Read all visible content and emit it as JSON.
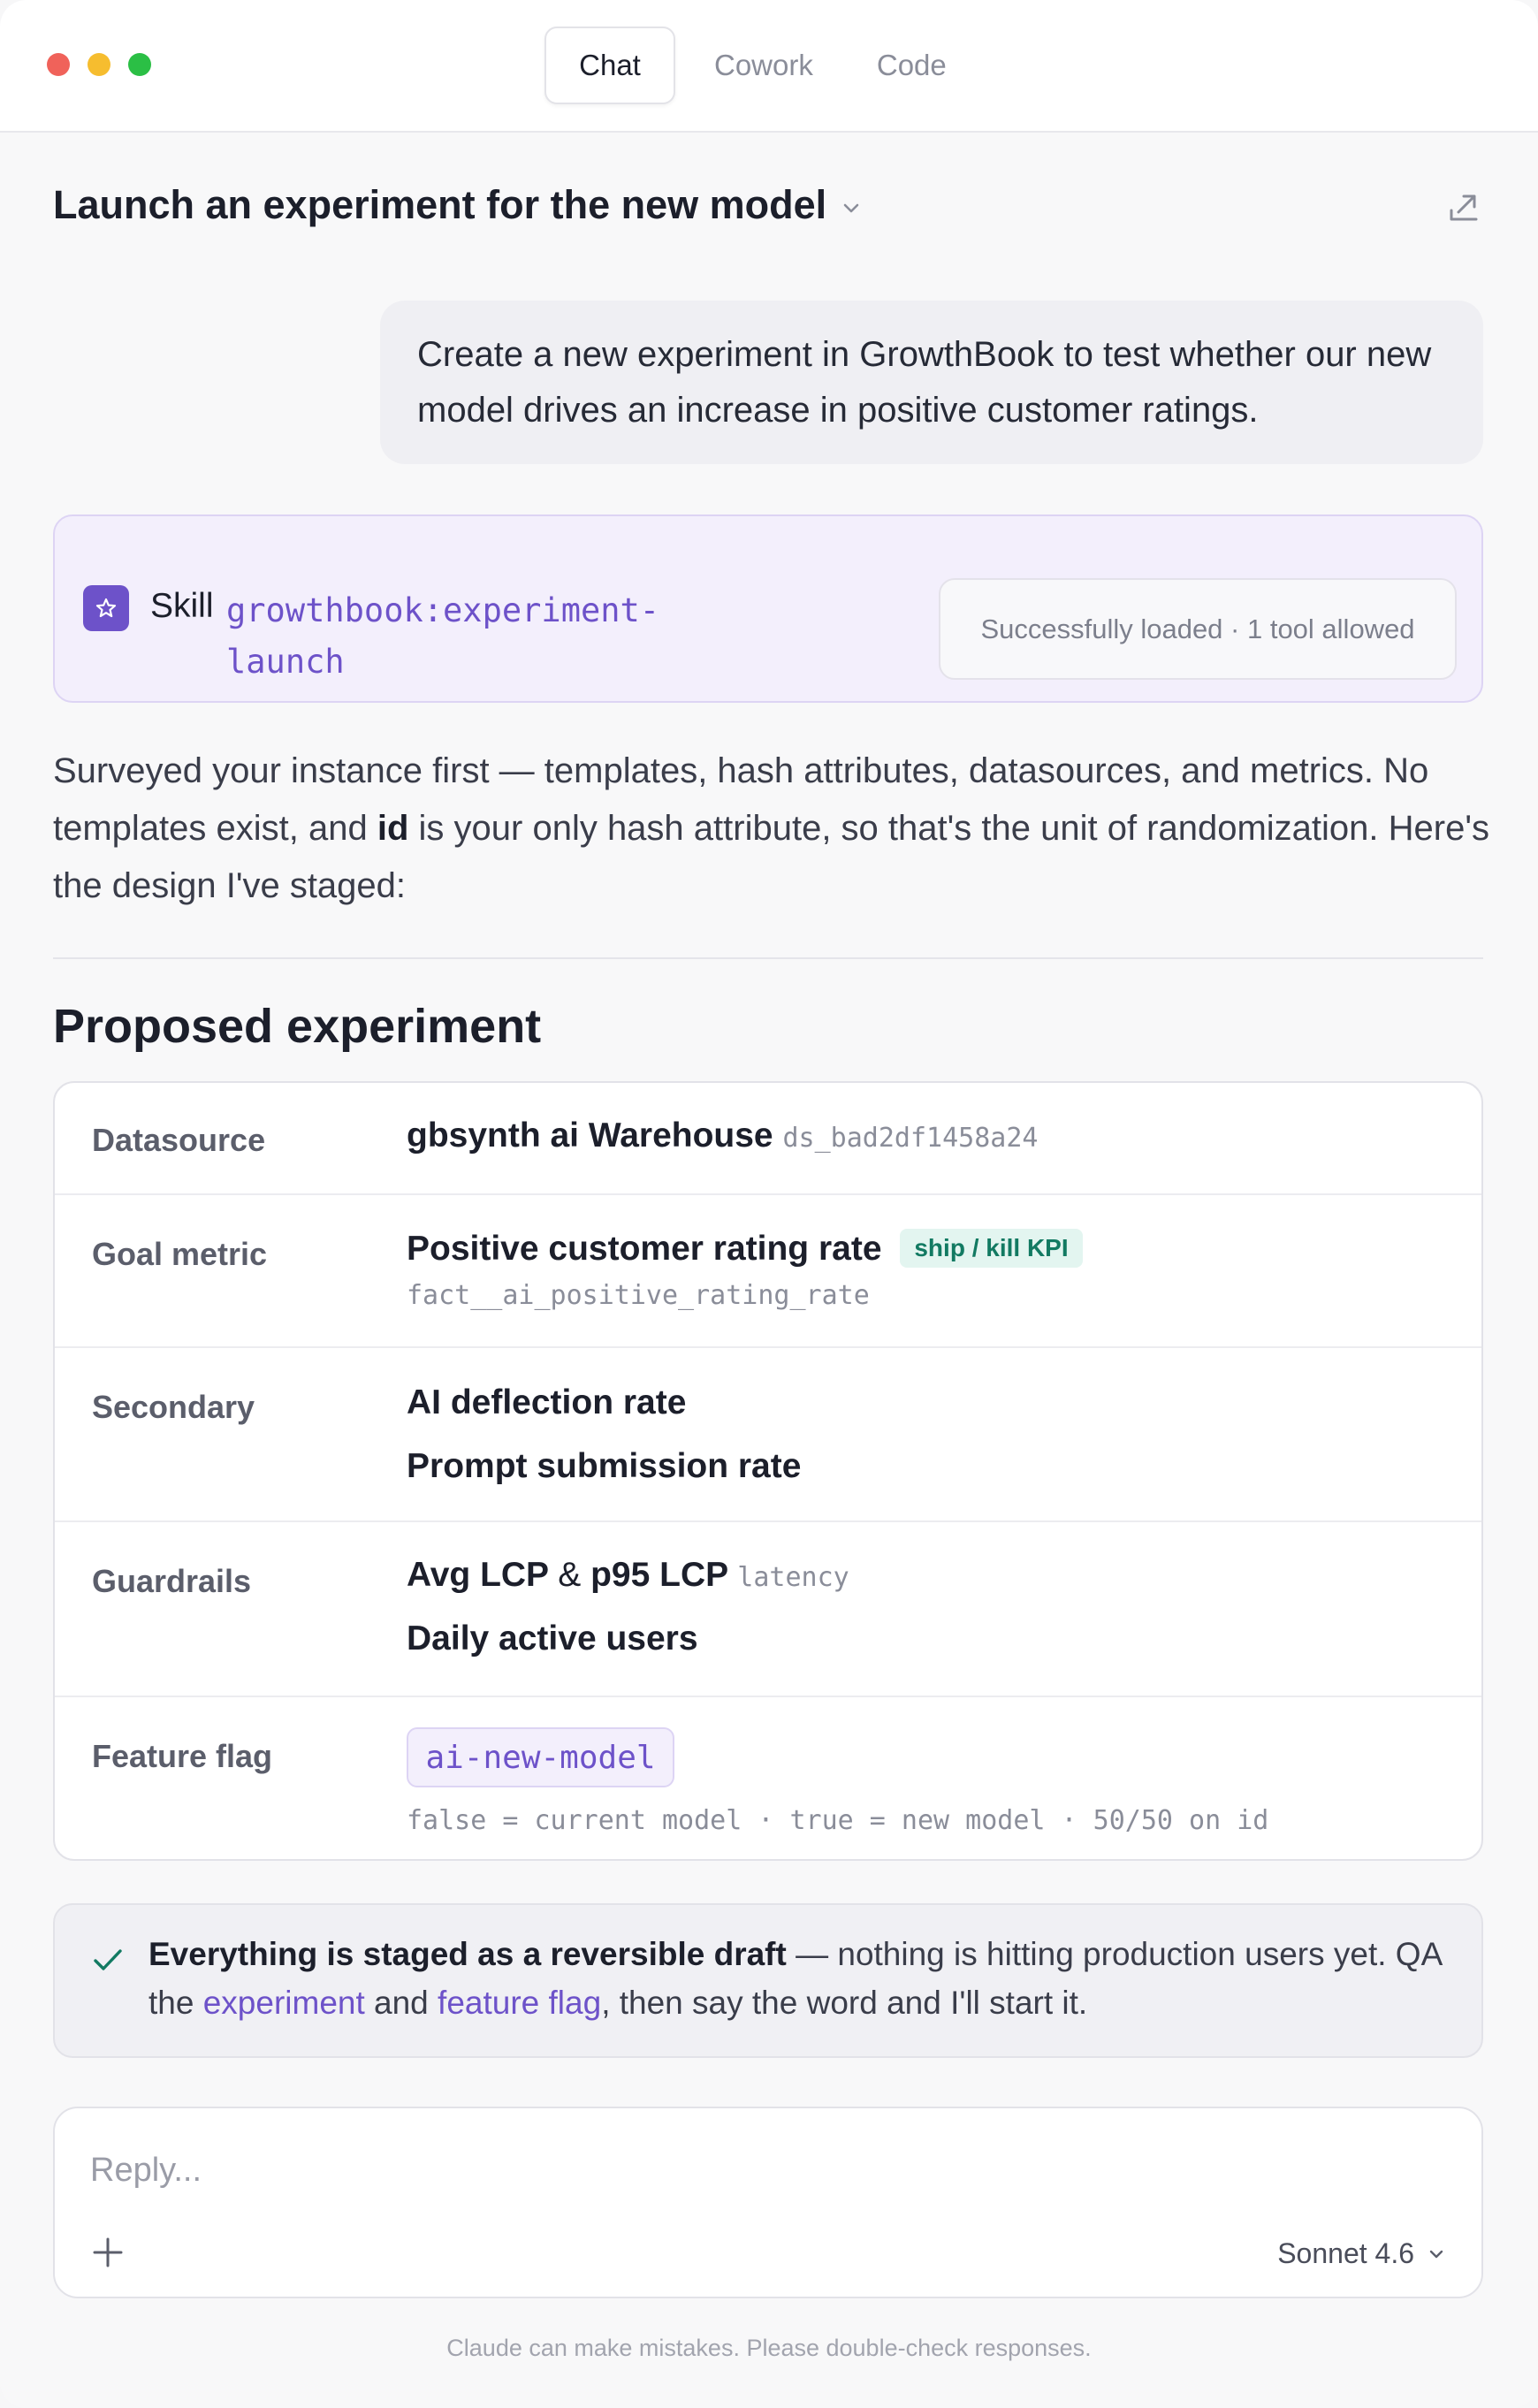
{
  "window": {
    "traffic_lights": [
      "close",
      "minimize",
      "zoom"
    ],
    "tabs": [
      {
        "label": "Chat",
        "active": true
      },
      {
        "label": "Cowork",
        "active": false
      },
      {
        "label": "Code",
        "active": false
      }
    ]
  },
  "header": {
    "title": "Launch an experiment for the new model",
    "title_icon": "chevron-down-icon",
    "action_icon": "share-icon"
  },
  "user_message": {
    "text": "Create a new experiment in GrowthBook to test whether our new model drives an increase in positive customer ratings."
  },
  "skill_card": {
    "label": "Skill",
    "name": "growthbook:experiment-launch",
    "name_line1": "growthbook:experiment-",
    "name_line2": "launch",
    "status": "Successfully loaded · 1 tool allowed",
    "icon": "star-icon"
  },
  "assistant": {
    "para_before": "Surveyed your instance first — templates, hash attributes, datasources, and metrics. No templates exist, and ",
    "para_bold": "id",
    "para_after": " is your only hash attribute, so that's the unit of randomization. Here's the design I've staged:"
  },
  "experiment": {
    "title": "Proposed experiment",
    "datasource": {
      "label": "Datasource",
      "name": "gbsynth ai Warehouse",
      "id": "ds_bad2df1458a24"
    },
    "goal_metric": {
      "label": "Goal metric",
      "name": "Positive customer rating rate",
      "badge": "ship / kill KPI",
      "id": "fact__ai_positive_rating_rate"
    },
    "secondary": {
      "label": "Secondary",
      "items": [
        "AI deflection rate",
        "Prompt submission rate"
      ]
    },
    "guardrails": {
      "label": "Guardrails",
      "line1": "Avg LCP",
      "amp": "&",
      "line1b": "p95 LCP",
      "tag": "latency",
      "line2": "Daily active users"
    },
    "feature_flag": {
      "label": "Feature flag",
      "key": "ai-new-model",
      "description": "false = current model · true = new model · 50/50 on id"
    }
  },
  "notice": {
    "icon": "check-icon",
    "bold": "Everything is staged as a reversible draft",
    "text1": " — nothing is hitting production users yet. QA the ",
    "link1": "experiment",
    "text2": " and ",
    "link2": "feature flag",
    "text3": ", then say the word and I'll start it."
  },
  "composer": {
    "placeholder": "Reply...",
    "add_icon": "plus-icon",
    "model": "Sonnet 4.6",
    "model_icon": "chevron-down-icon"
  },
  "footer": {
    "disclaimer": "Claude can make mistakes. Please double-check responses."
  },
  "colors": {
    "accent": "#6d52c9",
    "kpi_green": "#127a62",
    "traffic_red": "#f0625a",
    "traffic_yellow": "#f6bd2f",
    "traffic_green": "#2bbf45"
  }
}
